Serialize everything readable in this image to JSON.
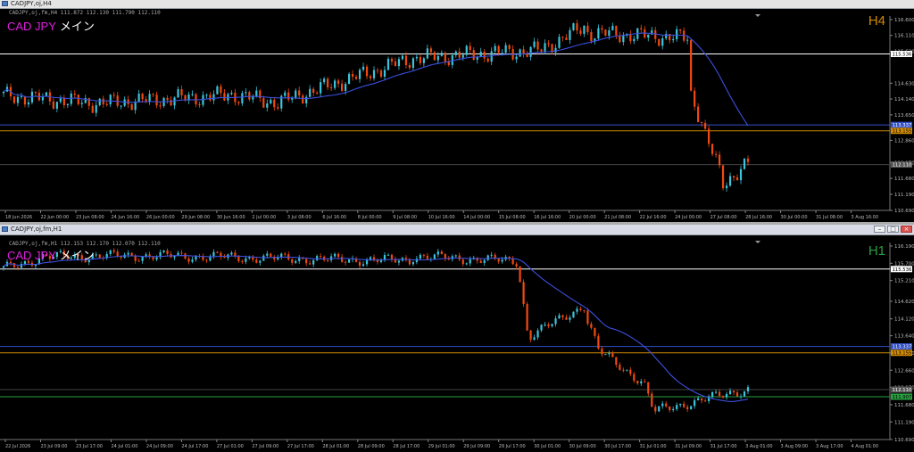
{
  "window1": {
    "title": "CADJPY,oj,H4",
    "info": "CADJPY,oj,fm,H4  111.872 112.130 111.790 112.110",
    "symbol_a": "CAD JPY",
    "symbol_b": "メイン",
    "timeframe": "H4",
    "price_axis": [
      "116.600",
      "116.110",
      "115.620",
      "114.630",
      "114.140",
      "113.650",
      "112.860",
      "112.170",
      "111.680",
      "111.190",
      "110.690"
    ],
    "price_tags": [
      {
        "value": "115.536",
        "color": "#ffffff",
        "text": "#000000"
      },
      {
        "value": "113.337",
        "color": "#3050c8",
        "text": "#ffffff"
      },
      {
        "value": "113.155",
        "color": "#d08a00",
        "text": "#000000"
      },
      {
        "value": "112.110",
        "color": "#555555",
        "text": "#ffffff"
      }
    ],
    "time_axis": [
      "18 Jun 2026",
      "22 Jun 00:00",
      "23 Jun 08:00",
      "24 Jun 16:00",
      "26 Jun 00:00",
      "29 Jun 08:00",
      "30 Jun 16:00",
      "2 Jul 00:00",
      "3 Jul 08:00",
      "6 Jul 16:00",
      "8 Jul 00:00",
      "9 Jul 08:00",
      "10 Jul 16:00",
      "14 Jul 00:00",
      "15 Jul 08:00",
      "16 Jul 16:00",
      "20 Jul 00:00",
      "21 Jul 08:00",
      "22 Jul 16:00",
      "24 Jul 00:00",
      "27 Jul 08:00",
      "28 Jul 16:00",
      "30 Jul 00:00",
      "31 Jul 08:00",
      "3 Aug 16:00"
    ]
  },
  "window2": {
    "title": "CADJPY,oj,fm,H1",
    "info": "CADJPY,oj,fm,H1  112.153 112.170 112.070 112.110",
    "symbol_a": "CAD JPY",
    "symbol_b": "メイン",
    "timeframe": "H1",
    "price_axis": [
      "116.190",
      "115.700",
      "115.210",
      "114.620",
      "114.120",
      "113.640",
      "113.150",
      "112.660",
      "112.170",
      "111.680",
      "111.190",
      "110.690"
    ],
    "price_tags": [
      {
        "value": "115.536",
        "color": "#ffffff",
        "text": "#000000"
      },
      {
        "value": "113.337",
        "color": "#3050c8",
        "text": "#ffffff"
      },
      {
        "value": "113.155",
        "color": "#d08a00",
        "text": "#000000"
      },
      {
        "value": "112.110",
        "color": "#555555",
        "text": "#ffffff"
      },
      {
        "value": "111.907",
        "color": "#28a040",
        "text": "#000000"
      }
    ],
    "time_axis": [
      "22 Jul 2026",
      "23 Jul 09:00",
      "23 Jul 17:00",
      "24 Jul 01:00",
      "24 Jul 09:00",
      "24 Jul 17:00",
      "27 Jul 01:00",
      "27 Jul 09:00",
      "27 Jul 17:00",
      "28 Jul 01:00",
      "28 Jul 09:00",
      "28 Jul 17:00",
      "29 Jul 01:00",
      "29 Jul 09:00",
      "29 Jul 17:00",
      "30 Jul 01:00",
      "30 Jul 09:00",
      "30 Jul 17:00",
      "31 Jul 01:00",
      "31 Jul 09:00",
      "31 Jul 17:00",
      "3 Aug 01:00",
      "3 Aug 09:00",
      "3 Aug 17:00",
      "4 Aug 01:00"
    ]
  },
  "colors": {
    "bull": "#3cc4dc",
    "bear": "#f04a10",
    "ma": "#3c50e0",
    "grid": "#555555"
  },
  "icons": {
    "window_icon": "chart-window-icon",
    "minimize": "minimize-icon",
    "maximize": "maximize-icon",
    "close": "close-icon"
  }
}
